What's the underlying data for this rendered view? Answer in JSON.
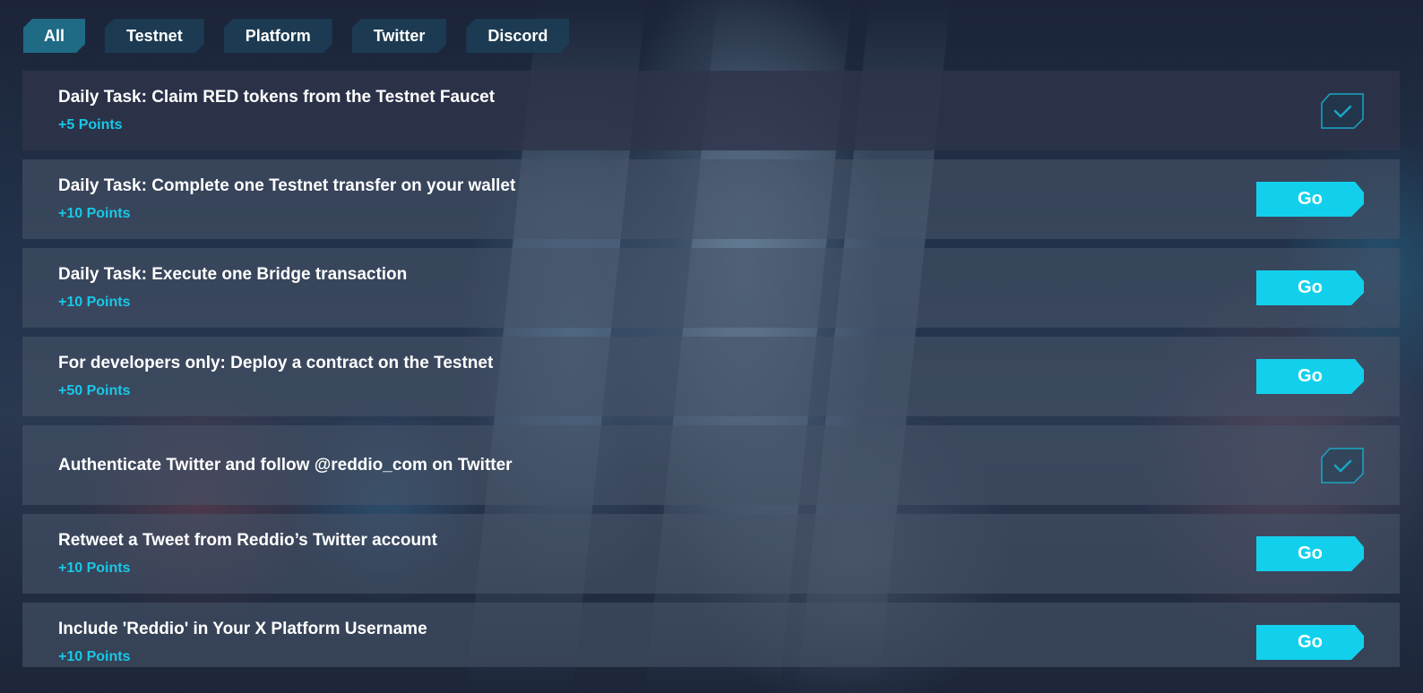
{
  "tabs": [
    {
      "label": "All",
      "active": true
    },
    {
      "label": "Testnet",
      "active": false
    },
    {
      "label": "Platform",
      "active": false
    },
    {
      "label": "Twitter",
      "active": false
    },
    {
      "label": "Discord",
      "active": false
    }
  ],
  "tasks": [
    {
      "title": "Daily Task: Claim RED tokens from the Testnet Faucet",
      "points": "+5 Points",
      "action": "completed"
    },
    {
      "title": "Daily Task: Complete one Testnet transfer on your wallet",
      "points": "+10 Points",
      "action": "go",
      "button_label": "Go"
    },
    {
      "title": "Daily Task: Execute one Bridge transaction",
      "points": "+10 Points",
      "action": "go",
      "button_label": "Go"
    },
    {
      "title": "For developers only: Deploy a contract on the Testnet",
      "points": "+50 Points",
      "action": "go",
      "button_label": "Go"
    },
    {
      "title": "Authenticate Twitter and follow @reddio_com on Twitter",
      "points": "",
      "action": "completed"
    },
    {
      "title": "Retweet a Tweet from Reddio’s Twitter account",
      "points": "+10 Points",
      "action": "go",
      "button_label": "Go"
    },
    {
      "title": "Include 'Reddio' in Your X Platform Username",
      "points": "+10 Points",
      "action": "go",
      "button_label": "Go"
    }
  ],
  "colors": {
    "accent": "#12d0ec",
    "points_text": "#18c8e6",
    "tab_active": "#1f6a85",
    "tab_inactive": "#1c3e56",
    "check_stroke": "#1aa6c4"
  },
  "icons": {
    "completed": "checkmark-icon"
  }
}
